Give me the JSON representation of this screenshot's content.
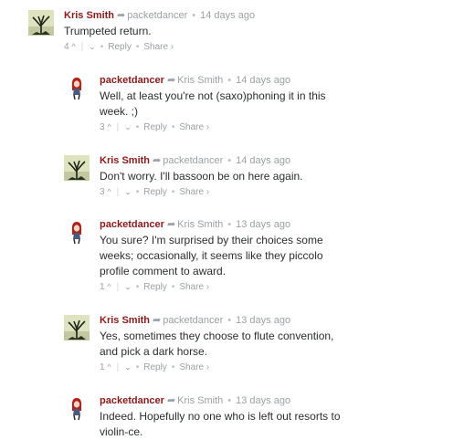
{
  "comments": [
    {
      "author": "Kris Smith",
      "arrow": "➦",
      "parent": "packetdancer",
      "time": "14 days ago",
      "message": "Trumpeted return.",
      "votes": "4",
      "upvote": "^",
      "downvote": "⌄",
      "reply": "Reply",
      "share": "Share ›",
      "avatar": "tree-avatar"
    },
    {
      "author": "packetdancer",
      "arrow": "➦",
      "parent": "Kris Smith",
      "time": "14 days ago",
      "message": "Well, at least you're not (saxo)phoning it in this week. ;)",
      "votes": "3",
      "upvote": "^",
      "downvote": "⌄",
      "reply": "Reply",
      "share": "Share ›",
      "avatar": "redhead-avatar"
    },
    {
      "author": "Kris Smith",
      "arrow": "➦",
      "parent": "packetdancer",
      "time": "14 days ago",
      "message": "Don't worry. I'll bassoon be on here again.",
      "votes": "3",
      "upvote": "^",
      "downvote": "⌄",
      "reply": "Reply",
      "share": "Share ›",
      "avatar": "tree-avatar"
    },
    {
      "author": "packetdancer",
      "arrow": "➦",
      "parent": "Kris Smith",
      "time": "13 days ago",
      "message": "You sure? I'm surprised by their choices some weeks; occasionally, it seems like they piccolo profile comment to award.",
      "votes": "1",
      "upvote": "^",
      "downvote": "⌄",
      "reply": "Reply",
      "share": "Share ›",
      "avatar": "redhead-avatar"
    },
    {
      "author": "Kris Smith",
      "arrow": "➦",
      "parent": "packetdancer",
      "time": "13 days ago",
      "message": "Yes, sometimes they choose to flute convention, and pick a dark horse.",
      "votes": "1",
      "upvote": "^",
      "downvote": "⌄",
      "reply": "Reply",
      "share": "Share ›",
      "avatar": "tree-avatar"
    },
    {
      "author": "packetdancer",
      "arrow": "➦",
      "parent": "Kris Smith",
      "time": "13 days ago",
      "message": "Indeed. Hopefully no one who is left out resorts to violin-ce.",
      "avatar": "redhead-avatar"
    }
  ],
  "bullet": "•",
  "separator": "|",
  "colors": {
    "author": "#8a1a1a",
    "meta": "#9aa0a4",
    "text": "#2a2e2e"
  }
}
